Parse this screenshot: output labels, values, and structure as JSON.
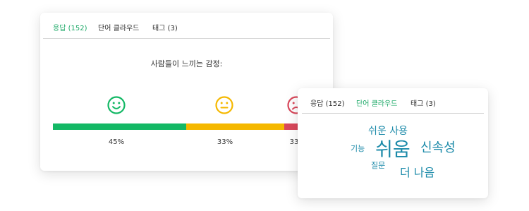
{
  "sentiment_panel": {
    "tabs": [
      {
        "label": "응답 (152)",
        "active": true
      },
      {
        "label": "단어 클라우드",
        "active": false
      },
      {
        "label": "태그 (3)",
        "active": false
      }
    ],
    "question": "사람들이 느끼는 감정:",
    "segments": [
      {
        "sentiment": "positive",
        "icon": "happy-face-icon",
        "percent": 45,
        "label": "45%",
        "color": "#13b865"
      },
      {
        "sentiment": "neutral",
        "icon": "neutral-face-icon",
        "percent": 33,
        "label": "33%",
        "color": "#f5b800"
      },
      {
        "sentiment": "negative",
        "icon": "sad-face-icon",
        "percent": 22,
        "label": "33",
        "color": "#d9485b"
      }
    ]
  },
  "word_cloud_panel": {
    "tabs": [
      {
        "label": "응답 (152)",
        "active": false
      },
      {
        "label": "단어 클라우드",
        "active": true
      },
      {
        "label": "태그 (3)",
        "active": false
      }
    ],
    "words": [
      {
        "text": "쉬운 사용"
      },
      {
        "text": "기능"
      },
      {
        "text": "쉬움"
      },
      {
        "text": "신속성"
      },
      {
        "text": "질문"
      },
      {
        "text": "더 나음"
      }
    ],
    "word_color": "#1b8aa9"
  }
}
